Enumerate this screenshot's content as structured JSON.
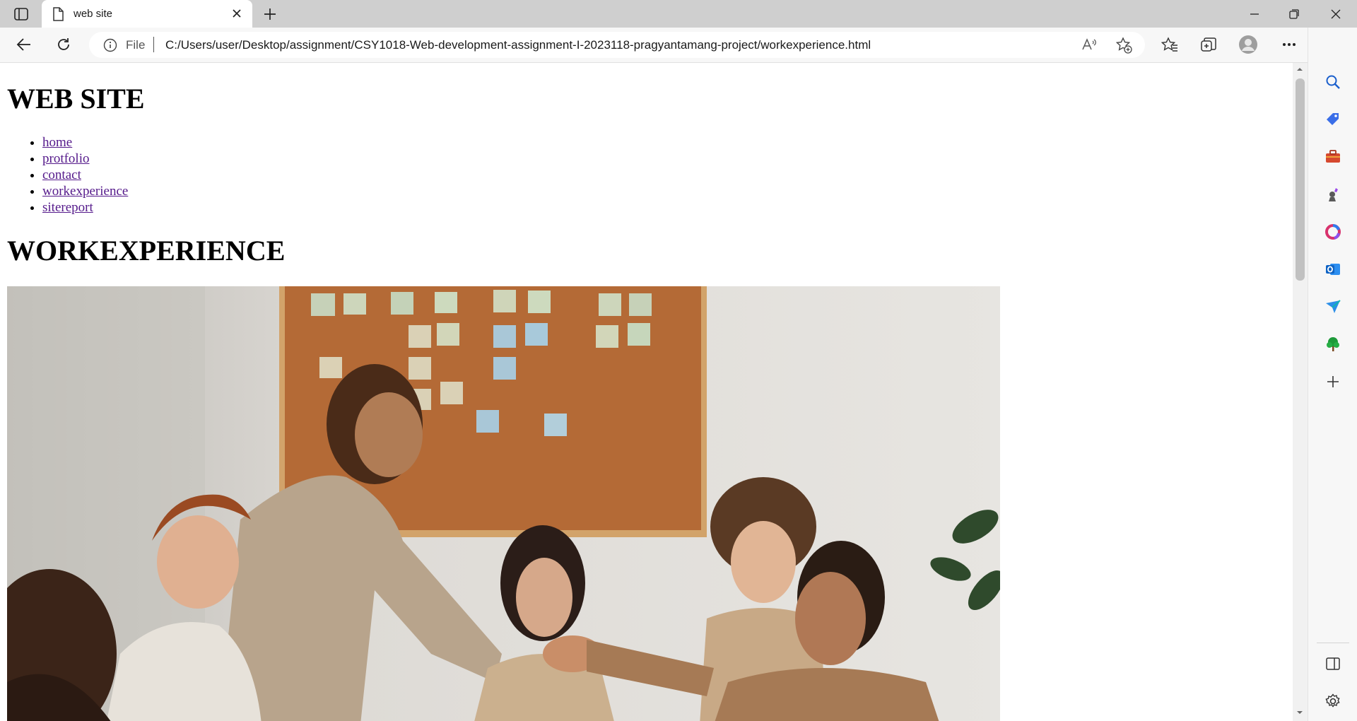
{
  "browser": {
    "tab": {
      "title": "web site"
    },
    "address_bar": {
      "scheme_label": "File",
      "url": "C:/Users/user/Desktop/assignment/CSY1018-Web-development-assignment-I-2023118-pragyantamang-project/workexperience.html"
    },
    "icons": {
      "sidebar_toggle": "tab-actions-icon",
      "page": "page-icon",
      "close": "close-icon",
      "new_tab": "plus-icon",
      "minimize": "minimize-icon",
      "restore": "restore-icon",
      "close_window": "close-window-icon",
      "back": "back-arrow-icon",
      "refresh": "refresh-icon",
      "info": "info-icon",
      "read_aloud": "read-aloud-icon",
      "add_favorite": "star-plus-icon",
      "favorites": "favorites-icon",
      "collections": "collections-icon",
      "profile": "profile-icon",
      "more": "more-icon",
      "copilot": "copilot-icon"
    }
  },
  "sidebar": {
    "items": [
      "search-icon",
      "shopping-tag-icon",
      "tools-icon",
      "games-icon",
      "office-icon",
      "outlook-icon",
      "send-icon",
      "tree-icon",
      "add-icon"
    ],
    "bottom": [
      "split-screen-icon",
      "settings-icon"
    ]
  },
  "page": {
    "site_title": "WEB SITE",
    "nav": [
      {
        "label": "home"
      },
      {
        "label": "protfolio"
      },
      {
        "label": "contact"
      },
      {
        "label": "workexperience"
      },
      {
        "label": "sitereport"
      }
    ],
    "section_title": "WORKEXPERIENCE",
    "hero_image": "team-meeting-handshake-photo"
  }
}
